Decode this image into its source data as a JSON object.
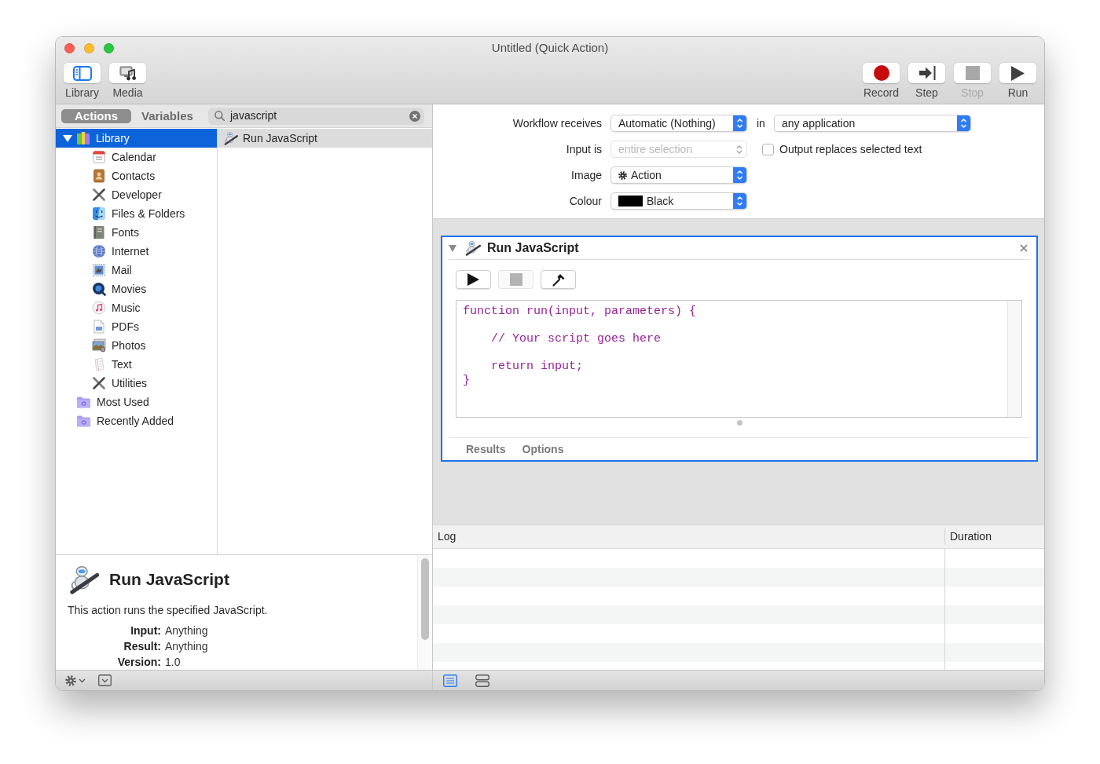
{
  "window": {
    "title": "Untitled (Quick Action)"
  },
  "toolbar": {
    "left": [
      {
        "kind": "library",
        "label": "Library"
      },
      {
        "kind": "media",
        "label": "Media"
      }
    ],
    "right": [
      {
        "kind": "record",
        "label": "Record",
        "disabled": false
      },
      {
        "kind": "step",
        "label": "Step",
        "disabled": false
      },
      {
        "kind": "stop",
        "label": "Stop",
        "disabled": true
      },
      {
        "kind": "run",
        "label": "Run",
        "disabled": false
      }
    ]
  },
  "library": {
    "tabs": [
      {
        "label": "Actions",
        "selected": true
      },
      {
        "label": "Variables",
        "selected": false
      }
    ],
    "search": {
      "value": "javascript"
    },
    "tree": [
      {
        "kind": "library",
        "label": "Library",
        "expanded": true,
        "selected": true,
        "children": [
          {
            "kind": "calendar",
            "label": "Calendar",
            "selected": false
          },
          {
            "kind": "contacts",
            "label": "Contacts",
            "selected": false
          },
          {
            "kind": "developer",
            "label": "Developer",
            "selected": false
          },
          {
            "kind": "files",
            "label": "Files & Folders",
            "selected": false
          },
          {
            "kind": "fonts",
            "label": "Fonts",
            "selected": false
          },
          {
            "kind": "internet",
            "label": "Internet",
            "selected": false
          },
          {
            "kind": "mail",
            "label": "Mail",
            "selected": false
          },
          {
            "kind": "movies",
            "label": "Movies",
            "selected": false
          },
          {
            "kind": "music",
            "label": "Music",
            "selected": false
          },
          {
            "kind": "pdfs",
            "label": "PDFs",
            "selected": false
          },
          {
            "kind": "photos",
            "label": "Photos",
            "selected": false
          },
          {
            "kind": "text",
            "label": "Text",
            "selected": false
          },
          {
            "kind": "utilities",
            "label": "Utilities",
            "selected": false
          }
        ]
      },
      {
        "kind": "smartfolder",
        "label": "Most Used",
        "selected": false
      },
      {
        "kind": "smartfolder",
        "label": "Recently Added",
        "selected": false
      }
    ],
    "results": [
      {
        "label": "Run JavaScript",
        "selected": true
      }
    ]
  },
  "description": {
    "title": "Run JavaScript",
    "text": "This action runs the specified JavaScript.",
    "fields": [
      {
        "label": "Input:",
        "value": "Anything"
      },
      {
        "label": "Result:",
        "value": "Anything"
      },
      {
        "label": "Version:",
        "value": "1.0"
      }
    ]
  },
  "workflow": {
    "receives": {
      "label": "Workflow receives",
      "value": "Automatic (Nothing)"
    },
    "application": {
      "label": "in",
      "value": "any application"
    },
    "input": {
      "label": "Input is",
      "value": "entire selection",
      "disabled": true
    },
    "output_replaces": {
      "label": "Output replaces selected text",
      "checked": false
    },
    "image": {
      "label": "Image",
      "value": "Action"
    },
    "colour": {
      "label": "Colour",
      "value": "Black",
      "color": "#000000"
    }
  },
  "action": {
    "title": "Run JavaScript",
    "expanded": true,
    "tools": [
      {
        "kind": "run",
        "disabled": false
      },
      {
        "kind": "stop",
        "disabled": true
      },
      {
        "kind": "compile",
        "disabled": false
      }
    ],
    "code": "function run(input, parameters) {\n\n    // Your script goes here\n\n    return input;\n}",
    "tabs": [
      {
        "label": "Results",
        "selected": false
      },
      {
        "label": "Options",
        "selected": false
      }
    ]
  },
  "log": {
    "columns": [
      "Log",
      "Duration"
    ]
  },
  "view_buttons": [
    {
      "kind": "list",
      "selected": true
    },
    {
      "kind": "split",
      "selected": false
    }
  ]
}
